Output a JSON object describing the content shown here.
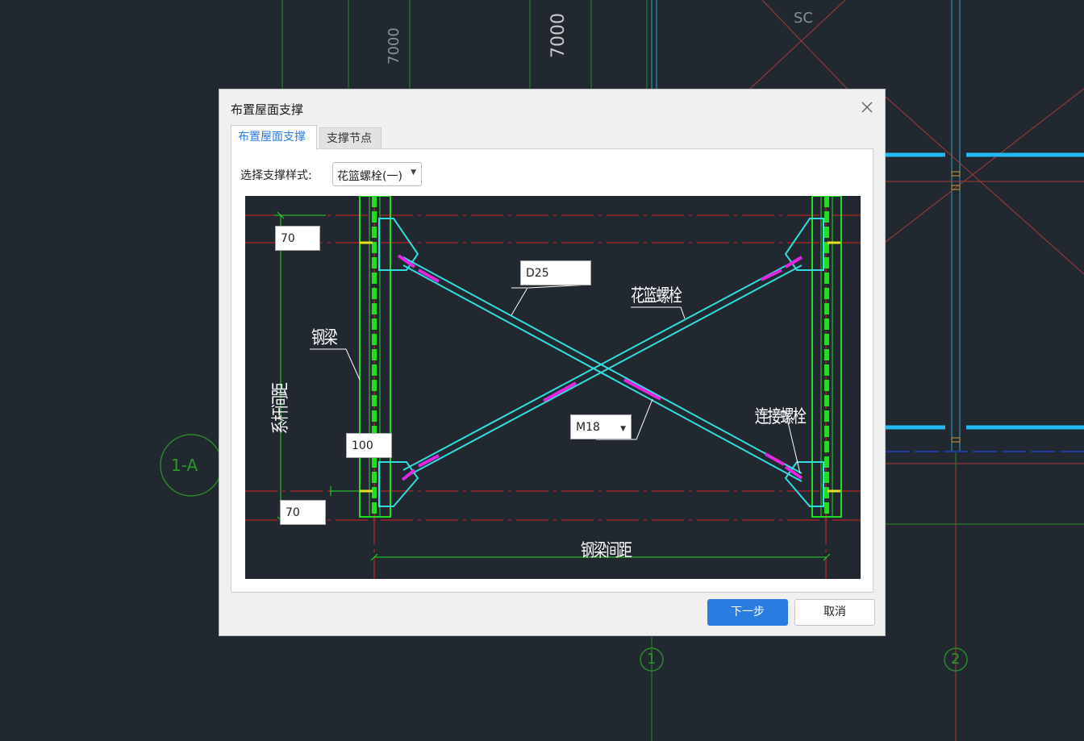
{
  "background": {
    "dim_labels": [
      "7000",
      "7000"
    ],
    "top_label": "SC",
    "axis_labels": [
      "1-A",
      "1",
      "2"
    ]
  },
  "dialog": {
    "title": "布置屋面支撑",
    "tabs": [
      {
        "label": "布置屋面支撑",
        "active": true
      },
      {
        "label": "支撑节点",
        "active": false
      }
    ],
    "style_label": "选择支撑样式:",
    "style_value": "花篮螺栓(一)",
    "preview": {
      "top_offset": "70",
      "rod_size": "D25",
      "bottom_edge": "100",
      "bottom_offset": "70",
      "bolt_size": "M18",
      "labels": {
        "steel_beam": "钢梁",
        "tie_spacing": "系杆间距",
        "turnbuckle": "花篮螺栓",
        "connecting_bolt": "连接螺栓",
        "beam_spacing": "钢梁间距"
      }
    },
    "buttons": {
      "next": "下一步",
      "cancel": "取消"
    }
  },
  "colors": {
    "cad_background": "#212830",
    "accent": "#2b7ce0",
    "member_green": "#22dd22",
    "brace_cyan": "#33dddd",
    "axis_red": "#dd2222"
  }
}
